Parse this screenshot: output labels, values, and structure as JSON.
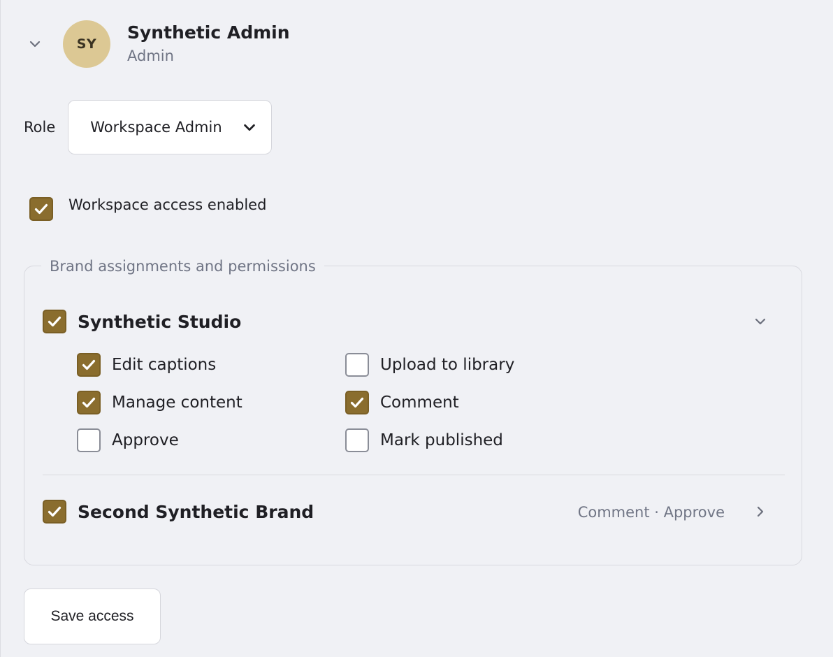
{
  "user": {
    "initials": "SY",
    "name": "Synthetic Admin",
    "role": "Admin"
  },
  "role_field": {
    "label": "Role",
    "selected": "Workspace Admin"
  },
  "workspace_access": {
    "label": "Workspace access enabled",
    "checked": true
  },
  "brands": {
    "legend": "Brand assignments and permissions",
    "items": [
      {
        "name": "Synthetic Studio",
        "checked": true,
        "expanded": true,
        "permissions": [
          {
            "label": "Edit captions",
            "checked": true
          },
          {
            "label": "Upload to library",
            "checked": false
          },
          {
            "label": "Manage content",
            "checked": true
          },
          {
            "label": "Comment",
            "checked": true
          },
          {
            "label": "Approve",
            "checked": false
          },
          {
            "label": "Mark published",
            "checked": false
          }
        ]
      },
      {
        "name": "Second Synthetic Brand",
        "checked": true,
        "expanded": false,
        "summary": "Comment · Approve"
      }
    ]
  },
  "actions": {
    "save_label": "Save access"
  },
  "colors": {
    "accent": "#8a6d2e",
    "avatar": "#dcc894",
    "background": "#f0f1f5",
    "muted_text": "#707585"
  }
}
